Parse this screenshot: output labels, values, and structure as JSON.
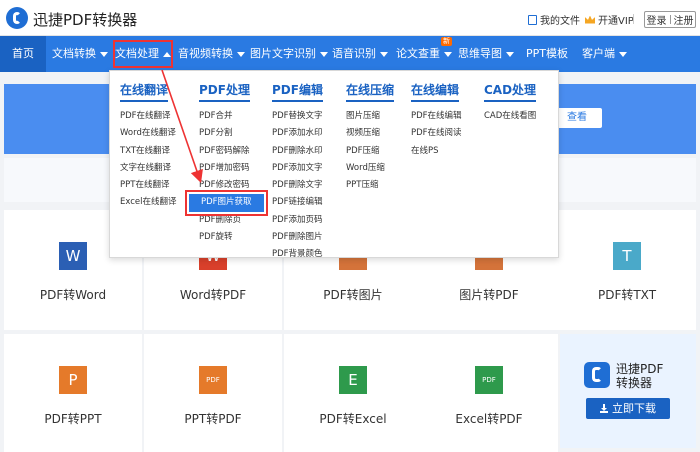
{
  "header": {
    "brand": "迅捷PDF转换器",
    "my_files": "我的文件",
    "vip": "开通VIP",
    "login": "登录",
    "register": "注册"
  },
  "nav": {
    "items": [
      {
        "label": "首页"
      },
      {
        "label": "文档转换"
      },
      {
        "label": "文档处理"
      },
      {
        "label": "音视频转换"
      },
      {
        "label": "图片文字识别"
      },
      {
        "label": "语音识别"
      },
      {
        "label": "论文查重"
      },
      {
        "label": "思维导图"
      },
      {
        "label": "PPT模板"
      },
      {
        "label": "客户端"
      }
    ],
    "new_badge": "新"
  },
  "banner": {
    "button": "查看"
  },
  "dropdown": {
    "columns": [
      {
        "title": "在线翻译",
        "items": [
          "PDF在线翻译",
          "Word在线翻译",
          "TXT在线翻译",
          "文字在线翻译",
          "PPT在线翻译",
          "Excel在线翻译"
        ]
      },
      {
        "title": "PDF处理",
        "items": [
          "PDF合并",
          "PDF分割",
          "PDF密码解除",
          "PDF增加密码",
          "PDF修改密码",
          "PDF图片获取",
          "PDF删除页",
          "PDF旋转"
        ]
      },
      {
        "title": "PDF编辑",
        "items": [
          "PDF替换文字",
          "PDF添加水印",
          "PDF删除水印",
          "PDF添加文字",
          "PDF删除文字",
          "PDF链接编辑",
          "PDF添加页码",
          "PDF删除图片",
          "PDF背景颜色"
        ]
      },
      {
        "title": "在线压缩",
        "items": [
          "图片压缩",
          "视频压缩",
          "PDF压缩",
          "Word压缩",
          "PPT压缩"
        ]
      },
      {
        "title": "在线编辑",
        "items": [
          "PDF在线编辑",
          "PDF在线阅读",
          "在线PS"
        ]
      },
      {
        "title": "CAD处理",
        "items": [
          "CAD在线看图"
        ]
      }
    ],
    "highlighted": "PDF图片获取"
  },
  "tiles": [
    {
      "label": "PDF转Word",
      "icon": "W",
      "color": "#2b5fb4"
    },
    {
      "label": "Word转PDF",
      "icon": "W",
      "color": "#d9402b"
    },
    {
      "label": "PDF转图片",
      "icon": "",
      "color": "#d4733a"
    },
    {
      "label": "图片转PDF",
      "icon": "",
      "color": "#d4733a"
    },
    {
      "label": "PDF转TXT",
      "icon": "T",
      "color": "#4aa9c9"
    },
    {
      "label": "PDF转PPT",
      "icon": "P",
      "color": "#e57a2a"
    },
    {
      "label": "PPT转PDF",
      "icon": "PDF",
      "color": "#e57a2a"
    },
    {
      "label": "PDF转Excel",
      "icon": "E",
      "color": "#2e9a4c"
    },
    {
      "label": "Excel转PDF",
      "icon": "PDF",
      "color": "#2e9a4c"
    }
  ],
  "promo": {
    "name_line1": "迅捷PDF",
    "name_line2": "转换器",
    "download": "立即下载"
  }
}
